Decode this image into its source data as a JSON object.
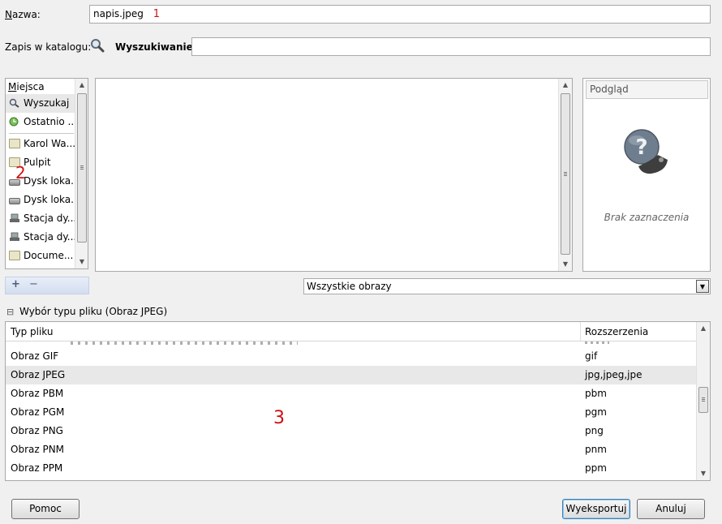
{
  "name_row": {
    "label": "Nazwa:",
    "value": "napis.jpeg",
    "annotation": "1"
  },
  "dir_row": {
    "label": "Zapis w katalogu:",
    "search_label": "Wyszukiwanie:",
    "search_value": ""
  },
  "places": {
    "header": "Miejsca",
    "items": [
      {
        "label": "Wyszukaj",
        "icon": "magnifier-icon"
      },
      {
        "label": "Ostatnio ...",
        "icon": "recent-icon"
      },
      {
        "label": "Karol Wa...",
        "icon": "folder-icon"
      },
      {
        "label": "Pulpit",
        "icon": "folder-icon"
      },
      {
        "label": "Dysk loka...",
        "icon": "drive-icon"
      },
      {
        "label": "Dysk loka...",
        "icon": "drive-icon"
      },
      {
        "label": "Stacja dy...",
        "icon": "floppy-icon"
      },
      {
        "label": "Stacja dy...",
        "icon": "floppy-icon"
      },
      {
        "label": "Docume...",
        "icon": "folder-icon"
      }
    ],
    "annotation": "2",
    "add_symbol": "+",
    "remove_symbol": "−"
  },
  "preview": {
    "title": "Podgląd",
    "empty_text": "Brak zaznaczenia",
    "icon_glyph": "?"
  },
  "filter": {
    "selected": "Wszystkie obrazy"
  },
  "filetype": {
    "toggle_symbol": "⊟",
    "label": "Wybór typu pliku (Obraz JPEG)",
    "columns": [
      "Typ pliku",
      "Rozszerzenia"
    ],
    "rows": [
      {
        "type": "Obraz GIF",
        "ext": "gif"
      },
      {
        "type": "Obraz JPEG",
        "ext": "jpg,jpeg,jpe",
        "selected": true
      },
      {
        "type": "Obraz PBM",
        "ext": "pbm"
      },
      {
        "type": "Obraz PGM",
        "ext": "pgm"
      },
      {
        "type": "Obraz PNG",
        "ext": "png"
      },
      {
        "type": "Obraz PNM",
        "ext": "pnm"
      },
      {
        "type": "Obraz PPM",
        "ext": "ppm"
      }
    ],
    "annotation": "3"
  },
  "buttons": {
    "help": "Pomoc",
    "export": "Wyeksportuj",
    "cancel": "Anuluj"
  },
  "colors": {
    "annotation": "#d01010",
    "selected_row": "#e8e8e8"
  }
}
